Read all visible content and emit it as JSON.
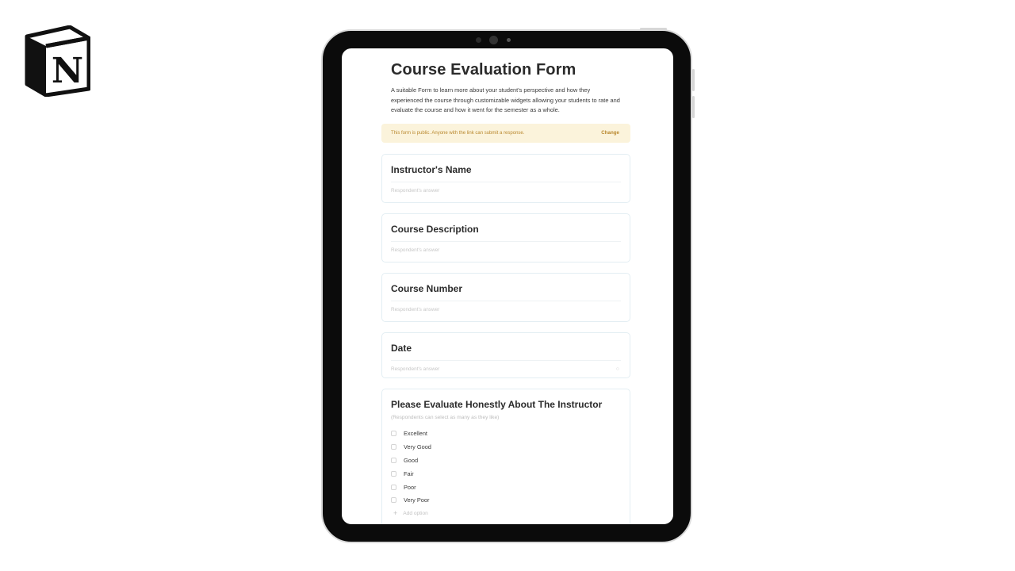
{
  "app": {
    "logo_letter": "N",
    "logo_name": "notion-logo"
  },
  "form": {
    "title": "Course Evaluation Form",
    "description": "A suitable Form to learn more about your student's perspective and how they experienced the course through customizable widgets allowing your students to rate and evaluate the course and how it went for the semester as a whole.",
    "banner": {
      "text": "This form is public. Anyone with the link can submit a response.",
      "action": "Change"
    },
    "questions": [
      {
        "title": "Instructor's Name",
        "placeholder": "Respondent's answer"
      },
      {
        "title": "Course Description",
        "placeholder": "Respondent's answer"
      },
      {
        "title": "Course Number",
        "placeholder": "Respondent's answer"
      },
      {
        "title": "Date",
        "placeholder": "Respondent's answer",
        "icon": "calendar-icon"
      }
    ],
    "multi_select": {
      "title": "Please Evaluate Honestly About The Instructor",
      "hint": "(Respondents can select as many as they like)",
      "options": [
        "Excellent",
        "Very Good",
        "Good",
        "Fair",
        "Poor",
        "Very Poor"
      ],
      "add_option": "Add option"
    }
  },
  "colors": {
    "banner_bg": "#fbf3db",
    "banner_text": "#b9882e",
    "card_border": "#e3eef3",
    "device_frame": "#0b0b0b"
  }
}
